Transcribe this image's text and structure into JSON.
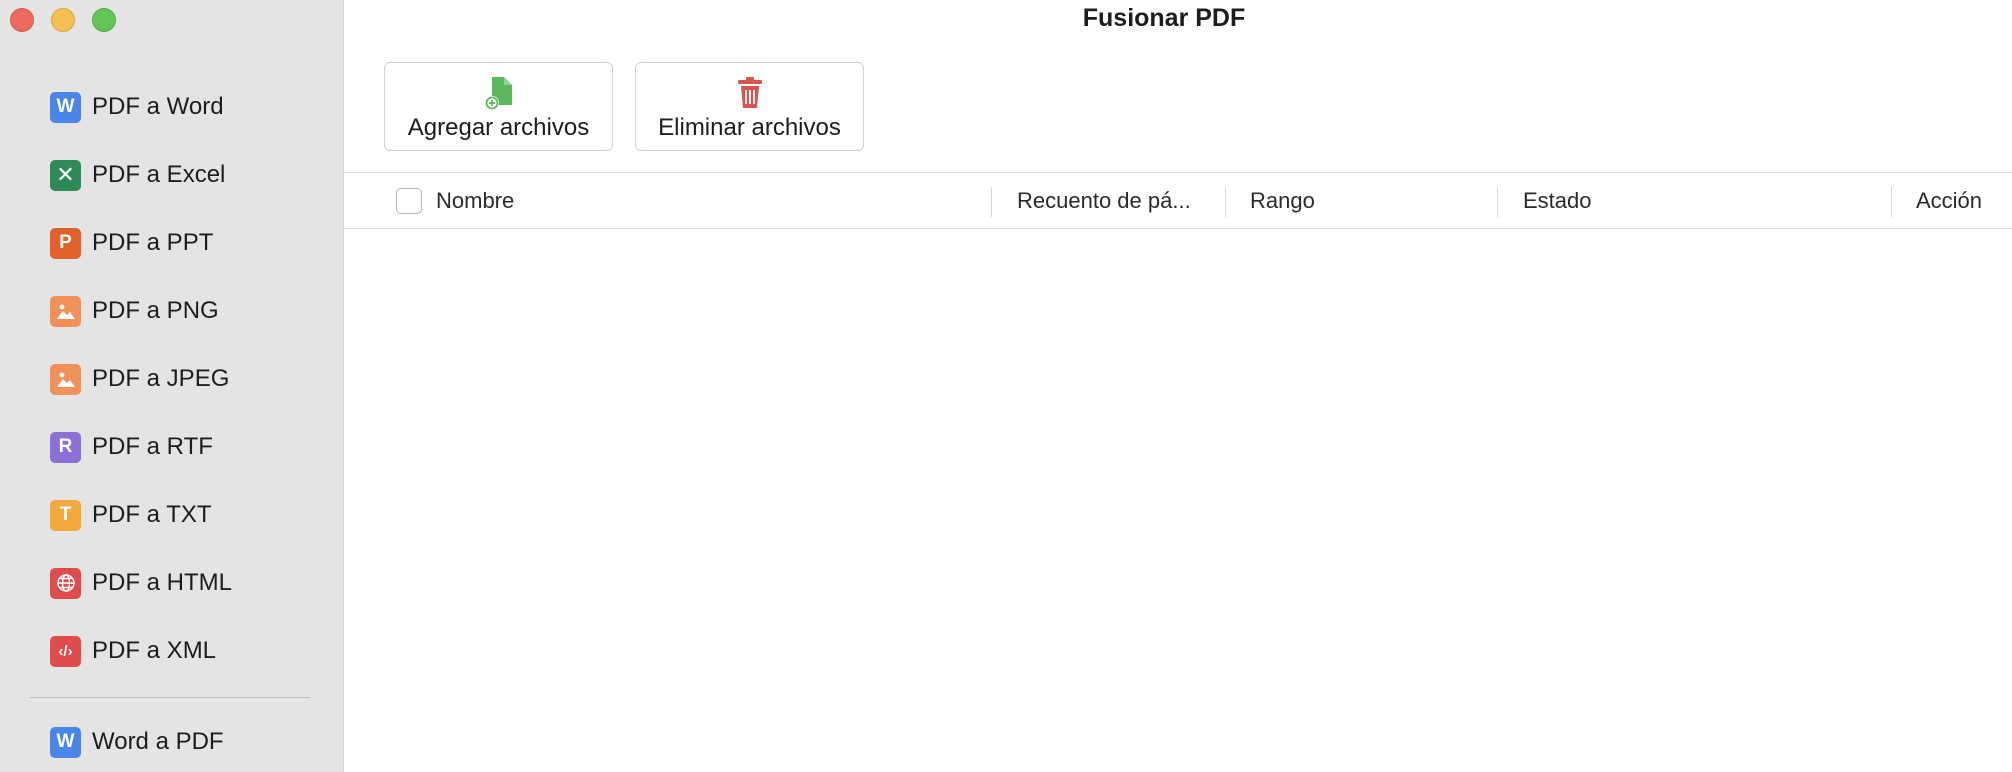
{
  "window": {
    "title": "Fusionar PDF",
    "controls": [
      "close",
      "minimize",
      "maximize"
    ]
  },
  "sidebar": {
    "items": [
      {
        "label": "PDF a Word",
        "icon": "word-icon",
        "glyph": "W",
        "color": "#4a86e8"
      },
      {
        "label": "PDF a Excel",
        "icon": "excel-icon",
        "glyph": "✕",
        "color": "#2e8b57"
      },
      {
        "label": "PDF a PPT",
        "icon": "ppt-icon",
        "glyph": "P",
        "color": "#e0622a"
      },
      {
        "label": "PDF a PNG",
        "icon": "image-icon",
        "glyph": "▲",
        "color": "#f0915a"
      },
      {
        "label": "PDF a JPEG",
        "icon": "image-icon",
        "glyph": "▲",
        "color": "#f0915a"
      },
      {
        "label": "PDF a RTF",
        "icon": "rtf-icon",
        "glyph": "R",
        "color": "#8b6fd6"
      },
      {
        "label": "PDF a TXT",
        "icon": "txt-icon",
        "glyph": "T",
        "color": "#f2a83b"
      },
      {
        "label": "PDF a HTML",
        "icon": "globe-icon",
        "glyph": "◍",
        "color": "#e04b4b"
      },
      {
        "label": "PDF a XML",
        "icon": "code-icon",
        "glyph": "‹/›",
        "color": "#e04b4b"
      },
      {
        "label": "Word a PDF",
        "icon": "word-icon",
        "glyph": "W",
        "color": "#4a86e8"
      }
    ]
  },
  "toolbar": {
    "add_label": "Agregar archivos",
    "remove_label": "Eliminar archivos",
    "add_color": "#5cb85c",
    "remove_color": "#d9534f"
  },
  "table": {
    "columns": [
      "Nombre",
      "Recuento de pá...",
      "Rango",
      "Estado",
      "Acción"
    ],
    "rows": []
  }
}
